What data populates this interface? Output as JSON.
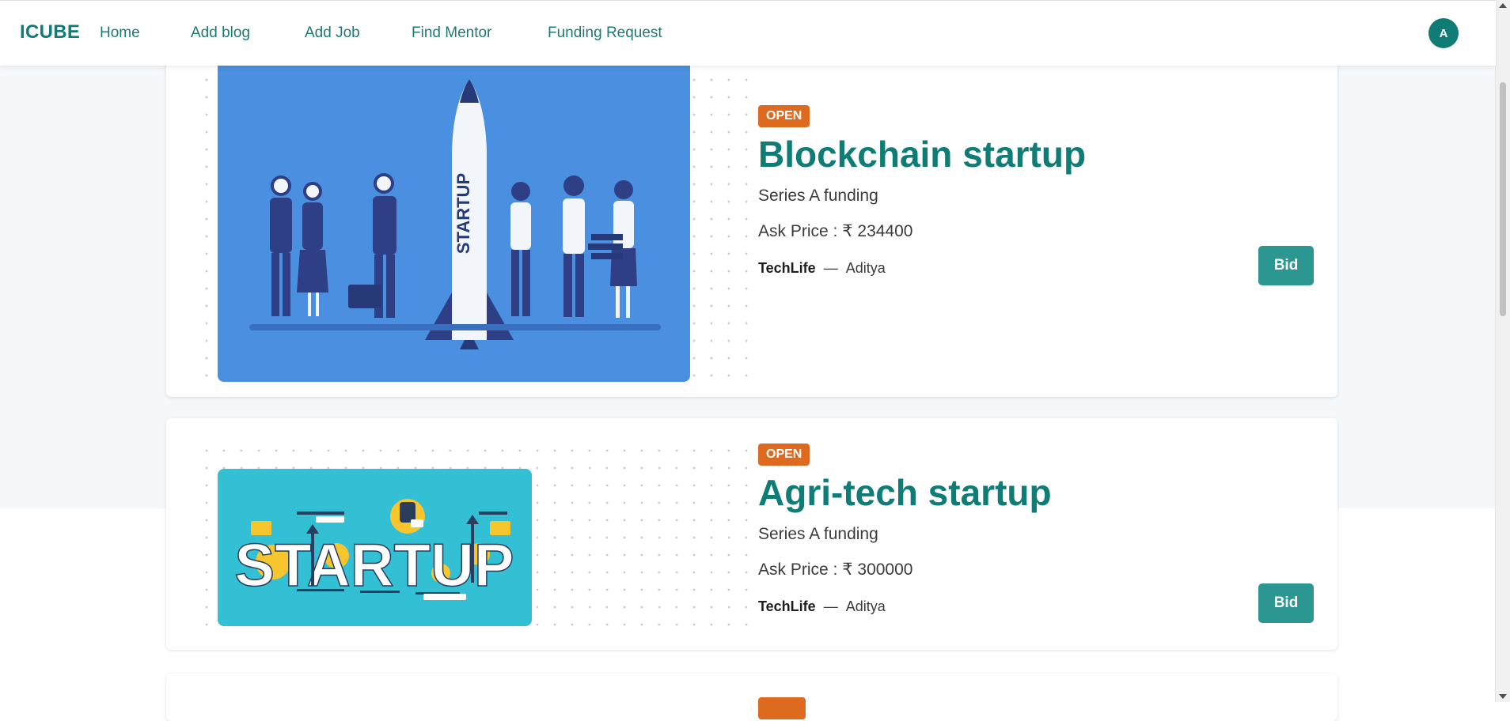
{
  "navbar": {
    "brand": "ICUBE",
    "links": [
      "Home",
      "Add blog",
      "Add Job",
      "Find Mentor",
      "Funding Request"
    ],
    "avatar_initial": "A"
  },
  "cards": [
    {
      "status": "OPEN",
      "title": "Blockchain startup",
      "subtitle": "Series A funding",
      "price_label": "Ask Price : ₹ 234400",
      "company": "TechLife",
      "separator": "—",
      "author": "Aditya",
      "bid_label": "Bid",
      "image_text": "STARTUP"
    },
    {
      "status": "OPEN",
      "title": "Agri-tech startup",
      "subtitle": "Series A funding",
      "price_label": "Ask Price : ₹ 300000",
      "company": "TechLife",
      "separator": "—",
      "author": "Aditya",
      "bid_label": "Bid",
      "image_text": "STARTUP"
    }
  ],
  "colors": {
    "brand": "#0f7c76",
    "badge": "#de6a1f",
    "button": "#2c9690",
    "image1_bg": "#4a8fe0",
    "image2_bg": "#33bfd4"
  }
}
